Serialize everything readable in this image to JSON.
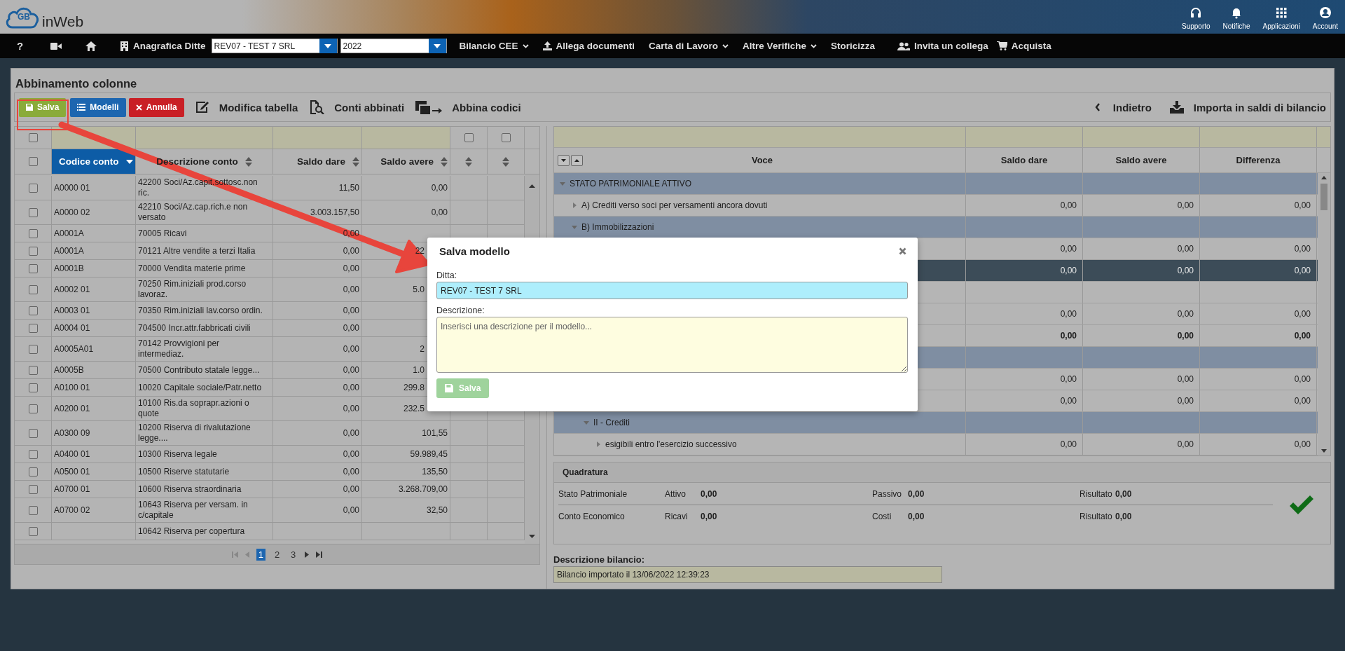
{
  "header": {
    "logo": "inWeb",
    "logo_mark": "GB",
    "actions": [
      {
        "label": "Supporto"
      },
      {
        "label": "Notifiche"
      },
      {
        "label": "Applicazioni"
      },
      {
        "label": "Account"
      }
    ]
  },
  "nav": {
    "help": "?",
    "company_label": "Anagrafica Ditte",
    "company": "REV07 - TEST 7 SRL",
    "year": "2022",
    "menus": [
      {
        "label": "Bilancio CEE",
        "kind": "dropdown"
      },
      {
        "label": "Allega documenti",
        "kind": "upload"
      },
      {
        "label": "Carta di Lavoro",
        "kind": "dropdown"
      },
      {
        "label": "Altre Verifiche",
        "kind": "dropdown"
      },
      {
        "label": "Storicizza",
        "kind": "plain"
      },
      {
        "label": "Invita un collega",
        "kind": "users"
      },
      {
        "label": "Acquista",
        "kind": "cart"
      }
    ]
  },
  "panel": {
    "title": "Abbinamento colonne"
  },
  "toolbar": {
    "save": "Salva",
    "models": "Modelli",
    "cancel": "Annulla",
    "tools": [
      {
        "label": "Modifica tabella",
        "kind": "edit"
      },
      {
        "label": "Conti abbinati",
        "kind": "search-file"
      },
      {
        "label": "Abbina codici",
        "kind": "match"
      }
    ],
    "back": "Indietro",
    "import": "Importa in saldi di bilancio"
  },
  "accounts": {
    "filter_checked": false,
    "all_checked": false,
    "columns": [
      {
        "label": "Codice conto",
        "sorted": true
      },
      {
        "label": "Descrizione conto",
        "sorted": false
      },
      {
        "label": "Saldo dare",
        "sorted": false
      },
      {
        "label": "Saldo avere",
        "sorted": false
      }
    ],
    "extra_columns": [
      {
        "checked": false
      },
      {
        "checked": false
      }
    ],
    "rows": [
      {
        "checked": false,
        "code": "A0000 01",
        "description": "42200 Soci/Az.capit.sottosc.non ric.",
        "dare": "11,50",
        "avere": "0,00"
      },
      {
        "checked": false,
        "code": "A0000 02",
        "description": "42210 Soci/Az.cap.rich.e non versato",
        "dare": "3.003.157,50",
        "avere": "0,00"
      },
      {
        "checked": false,
        "code": "A0001A",
        "description": "70005 Ricavi",
        "dare": "0,00"
      },
      {
        "checked": false,
        "code": "A0001A",
        "description": "70121 Altre vendite a terzi Italia",
        "dare": "0,00",
        "avere_cut": "22"
      },
      {
        "checked": false,
        "code": "A0001B",
        "description": "70000 Vendita materie prime",
        "dare": "0,00"
      },
      {
        "checked": false,
        "code": "A0002 01",
        "description": "70250 Rim.iniziali prod.corso lavoraz.",
        "dare": "0,00",
        "avere_cut": "5.0"
      },
      {
        "checked": false,
        "code": "A0003 01",
        "description": "70350 Rim.iniziali lav.corso ordin.",
        "dare": "0,00"
      },
      {
        "checked": false,
        "code": "A0004 01",
        "description": "704500 Incr.attr.fabbricati civili",
        "dare": "0,00"
      },
      {
        "checked": false,
        "code": "A0005A01",
        "description": "70142 Provvigioni per intermediaz.",
        "dare": "0,00",
        "avere_cut": "2"
      },
      {
        "checked": false,
        "code": "A0005B",
        "description": "70500 Contributo statale legge...",
        "dare": "0,00",
        "avere_cut": "1.0"
      },
      {
        "checked": false,
        "code": "A0100 01",
        "description": "10020 Capitale sociale/Patr.netto",
        "dare": "0,00",
        "avere_cut": "299.8"
      },
      {
        "checked": false,
        "code": "A0200 01",
        "description": "10100 Ris.da soprapr.azioni o quote",
        "dare": "0,00",
        "avere_cut": "232.5"
      },
      {
        "checked": false,
        "code": "A0300 09",
        "description": "10200 Riserva di rivalutazione legge....",
        "dare": "0,00",
        "avere": "101,55"
      },
      {
        "checked": false,
        "code": "A0400 01",
        "description": "10300 Riserva legale",
        "dare": "0,00",
        "avere": "59.989,45"
      },
      {
        "checked": false,
        "code": "A0500 01",
        "description": "10500 Riserve statutarie",
        "dare": "0,00",
        "avere": "135,50"
      },
      {
        "checked": false,
        "code": "A0700 01",
        "description": "10600 Riserva straordinaria",
        "dare": "0,00",
        "avere": "3.268.709,00"
      },
      {
        "checked": false,
        "code": "A0700 02",
        "description": "10643 Riserva per versam. in c/capitale",
        "dare": "0,00",
        "avere": "32,50"
      },
      {
        "checked": false,
        "description": "10642 Riserva per copertura"
      }
    ],
    "pages": [
      {
        "label": "1",
        "selected": true
      },
      {
        "label": "2",
        "selected": false
      },
      {
        "label": "3",
        "selected": false
      }
    ]
  },
  "report": {
    "columns": [
      "Voce",
      "Saldo dare",
      "Saldo avere",
      "Differenza"
    ],
    "rows": [
      {
        "kind": "group",
        "label": "STATO PATRIMONIALE ATTIVO",
        "expanded": true,
        "selected": false,
        "children": [
          {
            "kind": "item",
            "label": "A) Crediti verso soci per versamenti ancora dovuti",
            "expanded": false,
            "selected": false,
            "values": [
              "0,00",
              "0,00",
              "0,00"
            ]
          },
          {
            "kind": "group",
            "label": "B) Immobilizzazioni",
            "expanded": true,
            "selected": false,
            "children": [
              {
                "kind": "item",
                "selected": false,
                "values": [
                  "0,00",
                  "0,00",
                  "0,00"
                ]
              },
              {
                "kind": "item",
                "selected": true,
                "values": [
                  "0,00",
                  "0,00",
                  "0,00"
                ]
              },
              {
                "kind": "item",
                "selected": false
              },
              {
                "kind": "item",
                "selected": false,
                "values": [
                  "0,00",
                  "0,00",
                  "0,00"
                ]
              },
              {
                "kind": "total",
                "selected": false,
                "values": [
                  "0,00",
                  "0,00",
                  "0,00"
                ]
              },
              {
                "kind": "group",
                "selected": false
              },
              {
                "kind": "item",
                "selected": false,
                "values": [
                  "0,00",
                  "0,00",
                  "0,00"
                ]
              },
              {
                "kind": "item",
                "selected": false,
                "values": [
                  "0,00",
                  "0,00",
                  "0,00"
                ]
              },
              {
                "kind": "group",
                "label": "II - Crediti",
                "expanded": true,
                "selected": false,
                "children": [
                  {
                    "kind": "item",
                    "label": "esigibili entro l'esercizio successivo",
                    "expanded": false,
                    "selected": false,
                    "values": [
                      "0,00",
                      "0,00",
                      "0,00"
                    ]
                  }
                ]
              }
            ]
          }
        ]
      }
    ]
  },
  "quadratura": {
    "title": "Quadratura",
    "balanced": true,
    "rows": [
      {
        "label": "Stato Patrimoniale",
        "items": [
          {
            "label": "Attivo",
            "value": "0,00"
          },
          {
            "label": "Passivo",
            "value": "0,00"
          },
          {
            "label": "Risultato",
            "value": "0,00"
          }
        ]
      },
      {
        "label": "Conto Economico",
        "items": [
          {
            "label": "Ricavi",
            "value": "0,00"
          },
          {
            "label": "Costi",
            "value": "0,00"
          },
          {
            "label": "Risultato",
            "value": "0,00"
          }
        ]
      }
    ]
  },
  "balance_description": {
    "label": "Descrizione bilancio:",
    "value": "Bilancio importato il 13/06/2022 12:39:23"
  },
  "modal": {
    "title": "Salva modello",
    "company_label": "Ditta:",
    "company": "REV07 - TEST 7 SRL",
    "description_label": "Descrizione:",
    "description_placeholder": "Inserisci una descrizione per il modello...",
    "save": "Salva",
    "save_disabled": true
  }
}
